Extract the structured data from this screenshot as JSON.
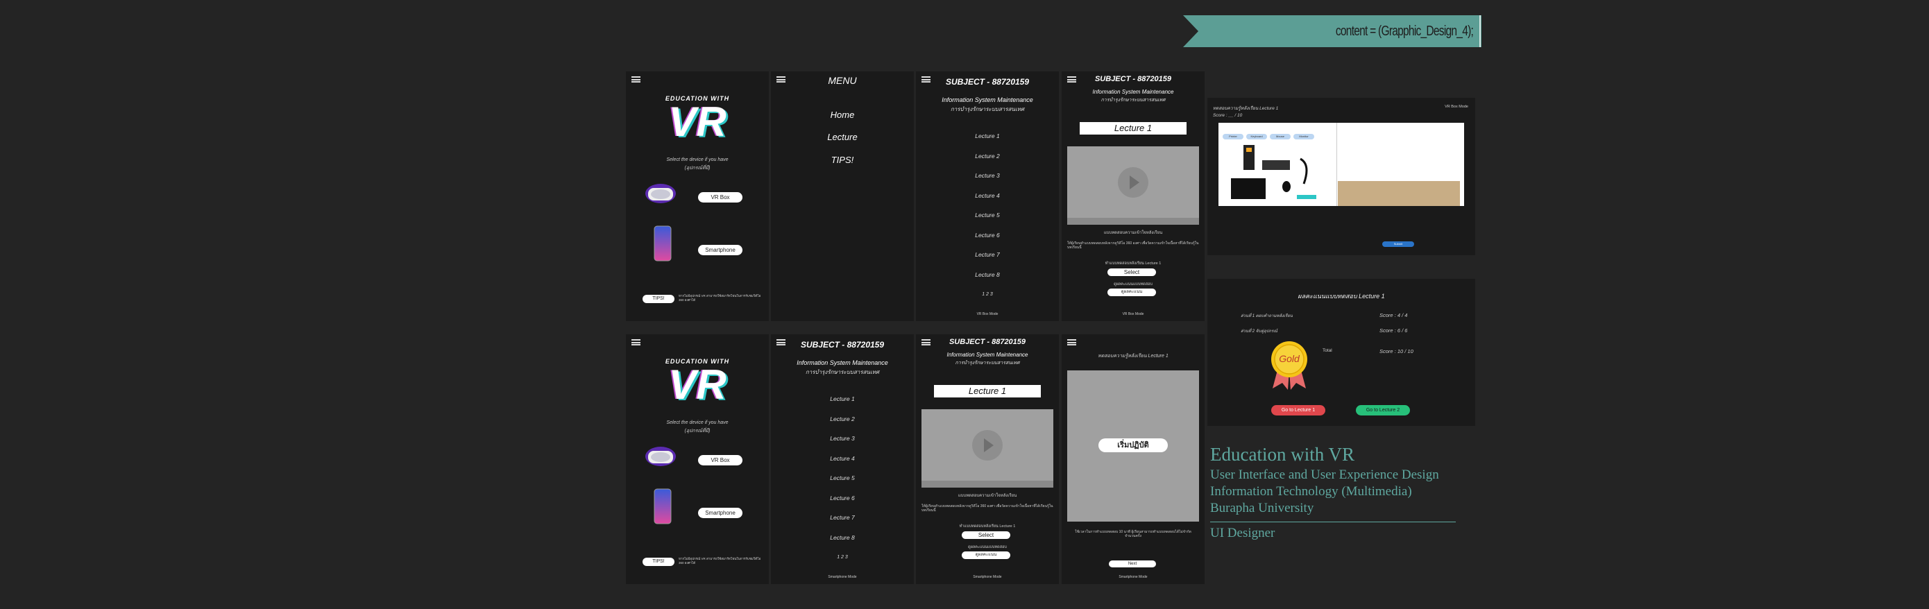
{
  "banner": {
    "text": "content = (Grapphic_Design_4);",
    "color": "#5c9e95"
  },
  "home": {
    "title_top": "EDUCATION WITH",
    "title_big": "VR",
    "select_text": "Select the device if you have",
    "select_sub": "(อุปกรณ์ที่มี)",
    "btn_vr": "VR Box",
    "btn_phone": "Smartphone",
    "tips_btn": "TIPS!",
    "tips_text": "หากไม่มีอุปกรณ์ VR สามารถใช้สมาร์ทโฟนในการรับชมวิดีโอ 360 องศาได้",
    "accent_vr": "#2cc6c6"
  },
  "menu": {
    "title": "MENU",
    "items": [
      "Home",
      "Lecture",
      "TIPS!"
    ]
  },
  "subject": {
    "code": "SUBJECT - 88720159",
    "name": "Information System Maintenance",
    "name_th": "การบำรุงรักษาระบบสารสนเทศ",
    "lectures": [
      "Lecture 1",
      "Lecture 2",
      "Lecture 3",
      "Lecture 4",
      "Lecture 5",
      "Lecture 6",
      "Lecture 7",
      "Lecture 8"
    ],
    "pagination": "1 2 3",
    "footer": "VR Box Mode"
  },
  "lecture": {
    "heading": "Lecture 1",
    "desc_title": "แบบทดสอบความเข้าใจหลังเรียน",
    "desc_text": "ให้ผู้เรียนทำแบบทดสอบหลังจากดูวิดีโอ 360 องศา เพื่อวัดความเข้าใจเนื้อหาที่ได้เรียนรู้ในบทเรียนนี้",
    "quiz_label": "ทำแบบทดสอบหลังเรียน Lecture 1",
    "select_btn": "Select",
    "result_label": "ดูผลคะแนนแบบทดสอบ",
    "result_btn": "ดูผลคะแนน",
    "footer": "VR Box Mode"
  },
  "quiz_phone": {
    "title": "ทดสอบความรู้หลังเรียน Lecture 1",
    "start_btn": "เริ่มปฏิบัติ",
    "note": "ใช้เวลาในการทำแบบทดสอบ 10 นาที ผู้เรียนสามารถทำแบบทดสอบได้ไม่จำกัดจำนวนครั้ง",
    "next_btn": "Next",
    "footer": "Smartphone Mode"
  },
  "desktop_quiz": {
    "title": "ทดสอบความรู้หลังเรียน Lecture 1",
    "score": "Score : __ / 10",
    "mode": "VR Box Mode",
    "tags": [
      "Printer",
      "Keyboard",
      "Mouse",
      "Monitor"
    ],
    "submit": "Submit"
  },
  "results": {
    "title": "ผลคะแนนแบบทดสอบ Lecture 1",
    "rows": [
      {
        "label": "ส่วนที่ 1 ตอบคำถามหลังเรียน",
        "score": "Score : 4 / 4"
      },
      {
        "label": "ส่วนที่ 2 จับคู่อุปกรณ์",
        "score": "Score : 6 / 6"
      }
    ],
    "total_label": "Total",
    "total_score": "Score : 10 / 10",
    "medal": "Gold",
    "btn_red": "Go to Lecture 1",
    "btn_green": "Go to Lecture 2",
    "red": "#e0474c",
    "green": "#27c07a"
  },
  "info": {
    "title": "Education with VR",
    "line1": "User Interface and User Experience Design",
    "line2": "Information Technology (Multimedia)",
    "line3": "Burapha University",
    "role": "UI Designer"
  }
}
